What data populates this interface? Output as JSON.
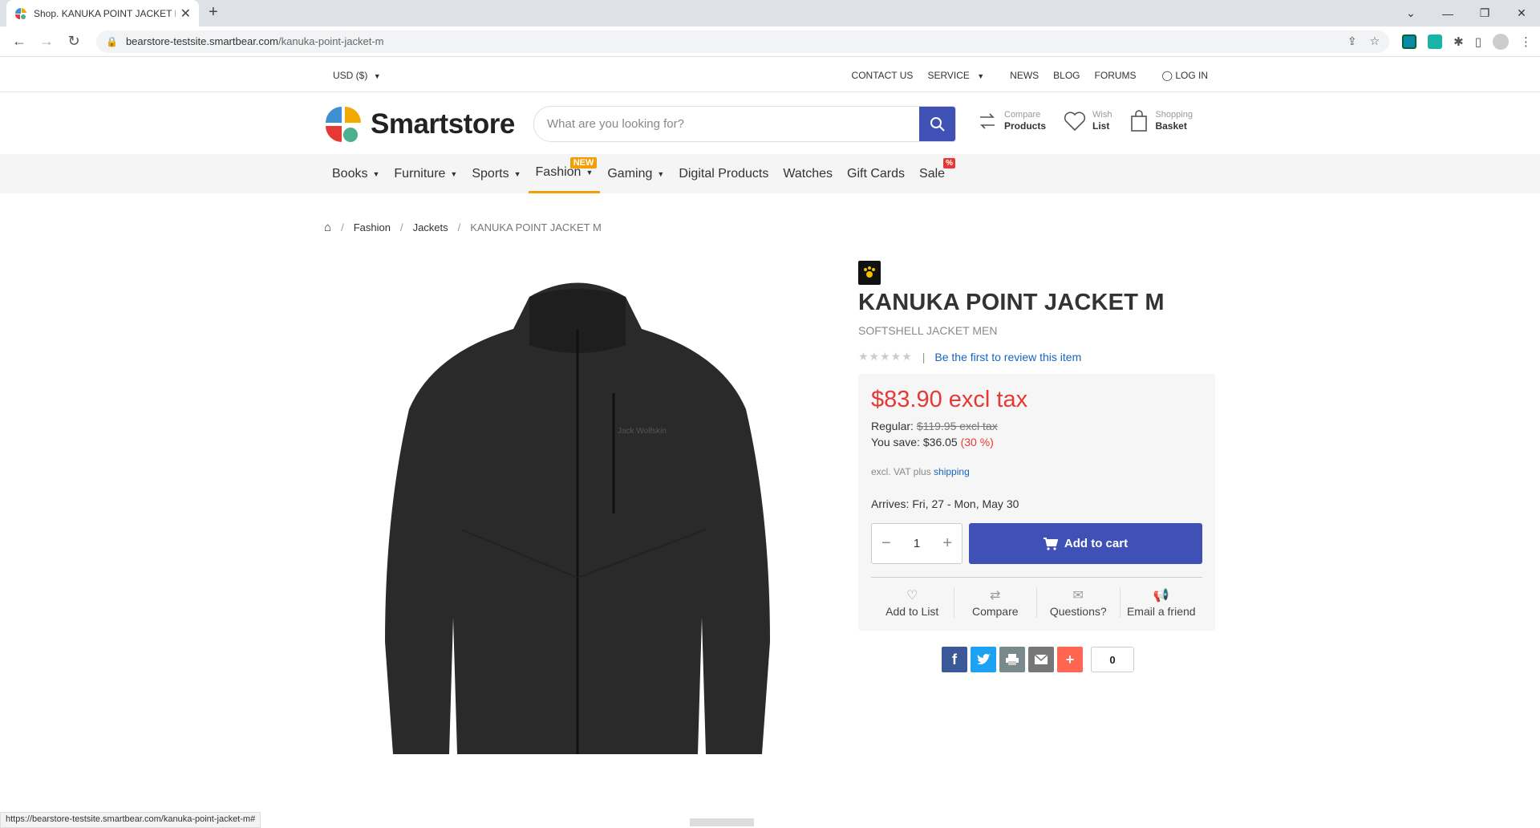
{
  "browser": {
    "tab_title": "Shop. KANUKA POINT JACKET M",
    "url_host": "bearstore-testsite.smartbear.com",
    "url_path": "/kanuka-point-jacket-m",
    "status_url": "https://bearstore-testsite.smartbear.com/kanuka-point-jacket-m#"
  },
  "utility": {
    "currency": "USD  ($)",
    "links": [
      "CONTACT US",
      "SERVICE",
      "NEWS",
      "BLOG",
      "FORUMS"
    ],
    "login": "LOG IN"
  },
  "header": {
    "logo_text": "Smartstore",
    "search_placeholder": "What are you looking for?",
    "compare_line1": "Compare",
    "compare_line2": "Products",
    "wish_line1": "Wish",
    "wish_line2": "List",
    "basket_line1": "Shopping",
    "basket_line2": "Basket"
  },
  "catnav": {
    "items": [
      "Books",
      "Furniture",
      "Sports",
      "Fashion",
      "Gaming",
      "Digital Products",
      "Watches",
      "Gift Cards",
      "Sale"
    ],
    "new_badge": "NEW",
    "sale_badge": "%"
  },
  "breadcrumb": {
    "items": [
      "Fashion",
      "Jackets"
    ],
    "current": "KANUKA POINT JACKET M"
  },
  "product": {
    "brand_logo_text": "Jack Wolfskin",
    "title": "KANUKA POINT JACKET M",
    "subtitle": "SOFTSHELL JACKET MEN",
    "rating_stars": 0,
    "review_link": "Be the first to review this item",
    "price": "$83.90 excl tax",
    "regular_label": "Regular:",
    "regular_price": "$119.95 excl tax",
    "save_label": "You save:",
    "save_amount": "$36.05",
    "save_percent": "(30 %)",
    "vat_text": "excl. VAT plus",
    "vat_link": "shipping",
    "arrives_label": "Arrives:",
    "arrives_value": "Fri, 27 - Mon, May 30",
    "quantity": "1",
    "add_to_cart": "Add to cart",
    "actions": [
      "Add to List",
      "Compare",
      "Questions?",
      "Email a friend"
    ],
    "share_count": "0"
  },
  "colors": {
    "accent": "#3f51b5",
    "price_red": "#e53935",
    "new_badge": "#f29f05",
    "facebook": "#3b5998",
    "twitter": "#1da1f2",
    "print": "#7a8a8c",
    "email": "#777777",
    "more": "#ff6550"
  }
}
